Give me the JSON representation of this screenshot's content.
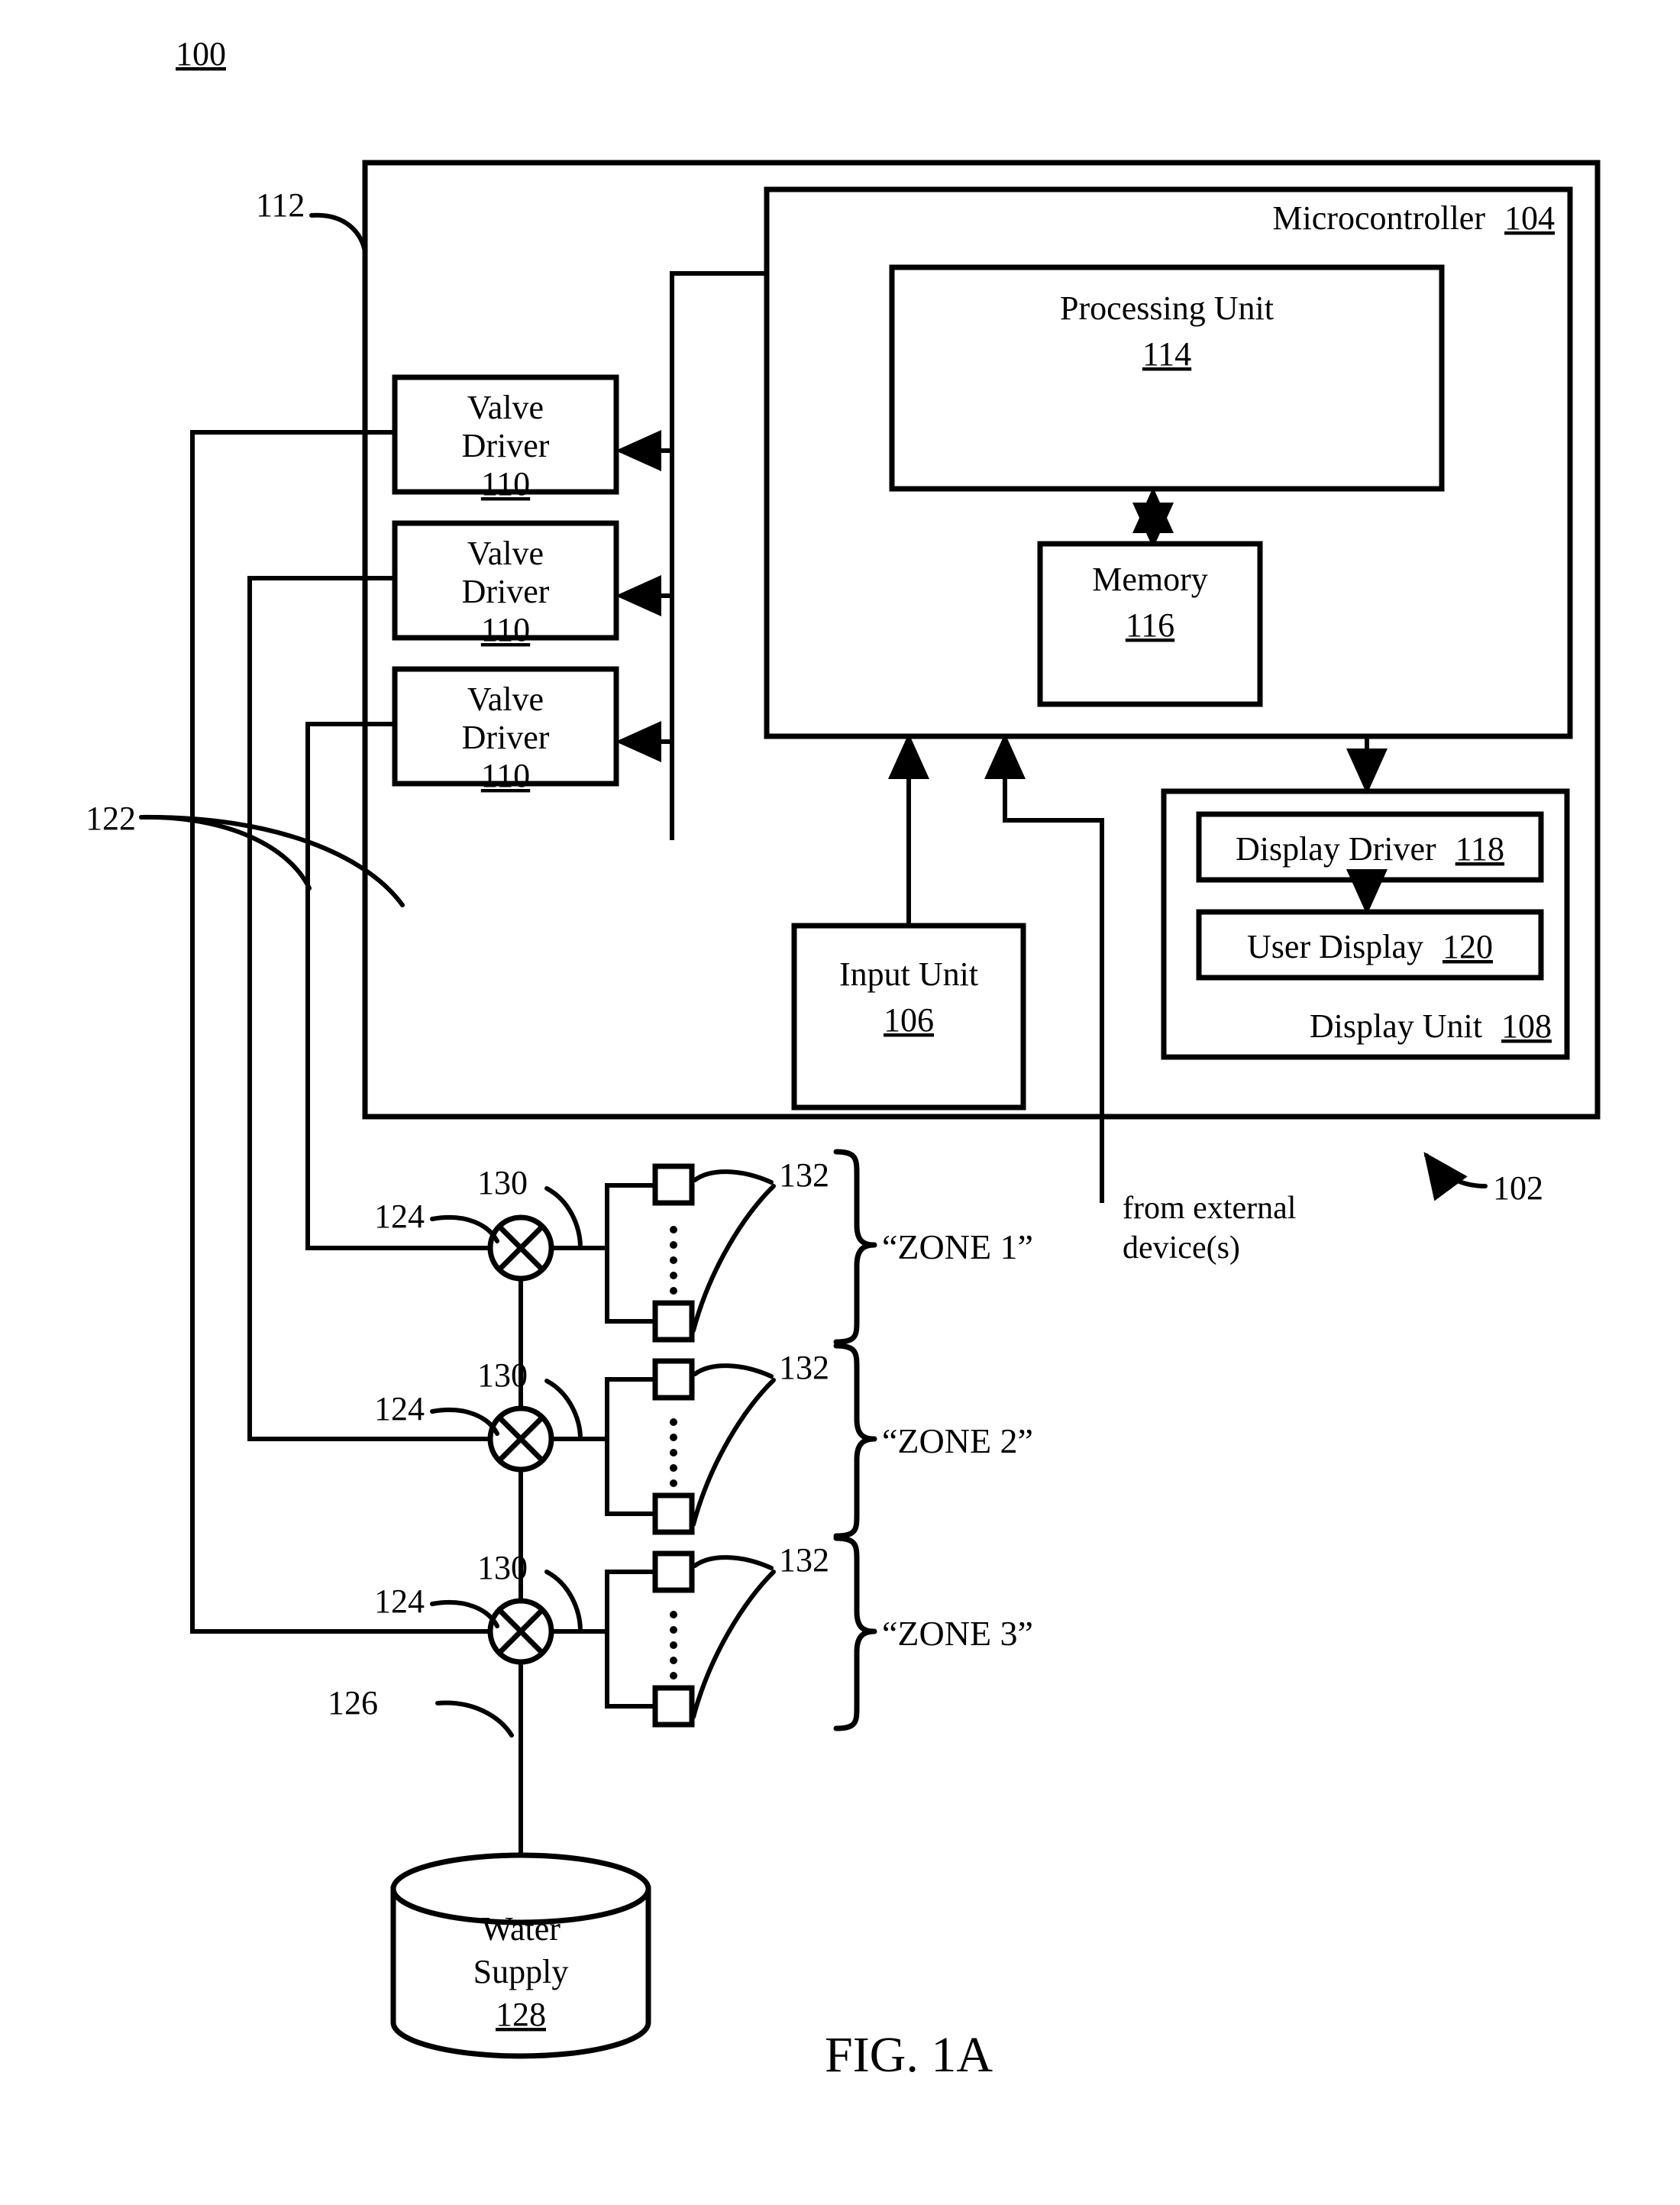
{
  "figure": {
    "caption": "FIG. 1A",
    "system_ref": "100",
    "controller_ref": "102",
    "housing_ref": "112"
  },
  "controller": {
    "microcontroller_label": "Microcontroller",
    "microcontroller_ref": "104",
    "processing_unit_label": "Processing Unit",
    "processing_unit_ref": "114",
    "memory_label": "Memory",
    "memory_ref": "116",
    "input_unit_label": "Input Unit",
    "input_unit_ref": "106",
    "display_unit_label": "Display Unit",
    "display_unit_ref": "108",
    "display_driver_label": "Display Driver",
    "display_driver_ref": "118",
    "user_display_label": "User Display",
    "user_display_ref": "120"
  },
  "valve_drivers": [
    {
      "line1": "Valve",
      "line2": "Driver",
      "ref": "110"
    },
    {
      "line1": "Valve",
      "line2": "Driver",
      "ref": "110"
    },
    {
      "line1": "Valve",
      "line2": "Driver",
      "ref": "110"
    }
  ],
  "wiring": {
    "control_wires_ref": "122",
    "valve_ref": "124",
    "pipe_ref": "130",
    "sprinkler_ref": "132",
    "supply_line_ref": "126"
  },
  "zones": [
    {
      "label": "“ZONE 1”",
      "valve_ref": "124",
      "pipe_ref": "130",
      "sprinkler_ref": "132"
    },
    {
      "label": "“ZONE 2”",
      "valve_ref": "124",
      "pipe_ref": "130",
      "sprinkler_ref": "132"
    },
    {
      "label": "“ZONE 3”",
      "valve_ref": "124",
      "pipe_ref": "130",
      "sprinkler_ref": "132"
    }
  ],
  "water_supply": {
    "line1": "Water",
    "line2": "Supply",
    "ref": "128"
  },
  "external": {
    "line1": "from external",
    "line2": "device(s)"
  },
  "colors": {
    "stroke": "#000000",
    "background": "#ffffff"
  }
}
